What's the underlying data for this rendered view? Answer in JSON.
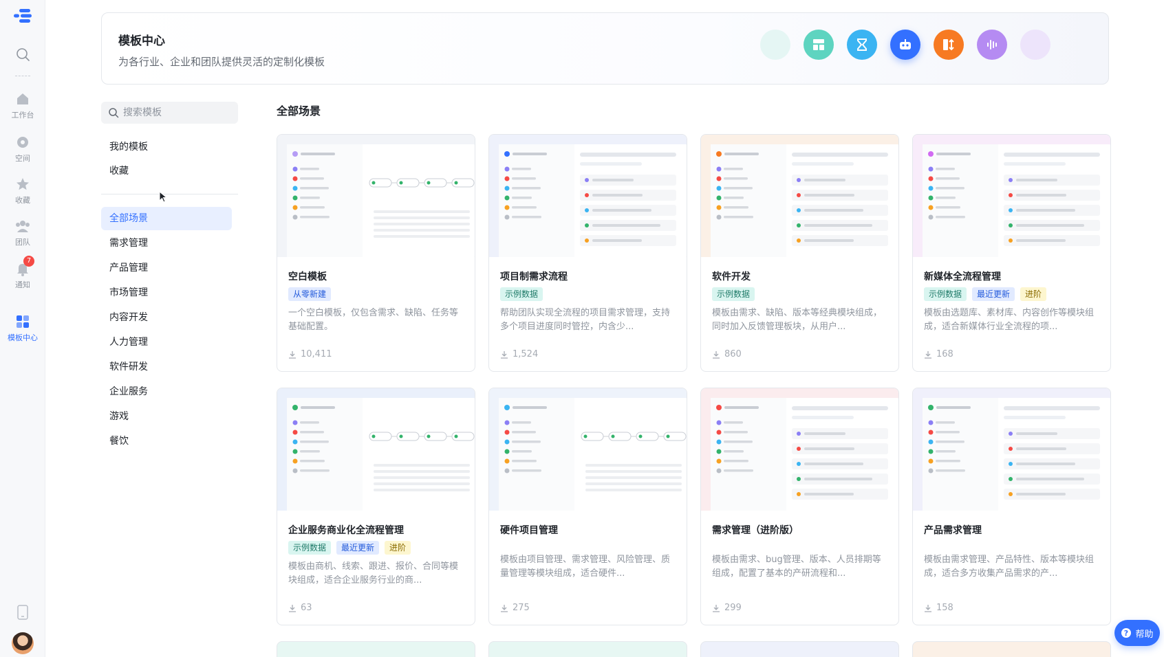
{
  "rail": {
    "items": [
      {
        "label": "工作台",
        "icon": "home-icon"
      },
      {
        "label": "空间",
        "icon": "space-icon"
      },
      {
        "label": "收藏",
        "icon": "star-icon"
      },
      {
        "label": "团队",
        "icon": "team-icon"
      },
      {
        "label": "通知",
        "icon": "bell-icon",
        "badge": "7"
      },
      {
        "label": "模板中心",
        "icon": "template-icon",
        "active": true
      }
    ]
  },
  "banner": {
    "title": "模板中心",
    "subtitle": "为各行业、企业和团队提供灵活的定制化模板"
  },
  "search": {
    "placeholder": "搜索模板"
  },
  "nav": {
    "top": [
      "我的模板",
      "收藏"
    ],
    "categories": [
      "全部场景",
      "需求管理",
      "产品管理",
      "市场管理",
      "内容开发",
      "人力管理",
      "软件研发",
      "企业服务",
      "游戏",
      "餐饮"
    ],
    "active": "全部场景"
  },
  "section": {
    "title": "全部场景"
  },
  "cards": [
    {
      "title": "空白模板",
      "tags": [
        {
          "text": "从零新建",
          "color": "blue"
        }
      ],
      "desc": "一个空白模板，仅包含需求、缺陷、任务等基础配置。",
      "downloads": "10,411"
    },
    {
      "title": "项目制需求流程",
      "tags": [
        {
          "text": "示例数据",
          "color": "green"
        }
      ],
      "desc": "帮助团队实现全流程的项目需求管理，支持多个项目进度同时管控，内含少...",
      "downloads": "1,524"
    },
    {
      "title": "软件开发",
      "tags": [
        {
          "text": "示例数据",
          "color": "green"
        }
      ],
      "desc": "模板由需求、缺陷、版本等经典模块组成，同时加入反馈管理板块，从用户...",
      "downloads": "860"
    },
    {
      "title": "新媒体全流程管理",
      "tags": [
        {
          "text": "示例数据",
          "color": "green"
        },
        {
          "text": "最近更新",
          "color": "blue"
        },
        {
          "text": "进阶",
          "color": "yellow"
        }
      ],
      "desc": "模板由选题库、素材库、内容创作等模块组成，适合新媒体行业全流程的项...",
      "downloads": "168"
    },
    {
      "title": "企业服务商业化全流程管理",
      "tags": [
        {
          "text": "示例数据",
          "color": "green"
        },
        {
          "text": "最近更新",
          "color": "blue"
        },
        {
          "text": "进阶",
          "color": "yellow"
        }
      ],
      "desc": "模板由商机、线索、跟进、报价、合同等模块组成，适合企业服务行业的商...",
      "downloads": "63"
    },
    {
      "title": "硬件项目管理",
      "tags": [],
      "desc": "模板由项目管理、需求管理、风险管理、质量管理等模块组成，适合硬件...",
      "downloads": "275"
    },
    {
      "title": "需求管理（进阶版）",
      "tags": [],
      "desc": "模板由需求、bug管理、版本、人员排期等组成，配置了基本的产研流程和...",
      "downloads": "299"
    },
    {
      "title": "产品需求管理",
      "tags": [],
      "desc": "模板由需求管理、产品特性、版本等模块组成，适合多方收集产品需求的产...",
      "downloads": "158"
    }
  ],
  "help": {
    "label": "帮助"
  },
  "colors": {
    "accent": "#3370ff",
    "badge": "#f54a45"
  }
}
